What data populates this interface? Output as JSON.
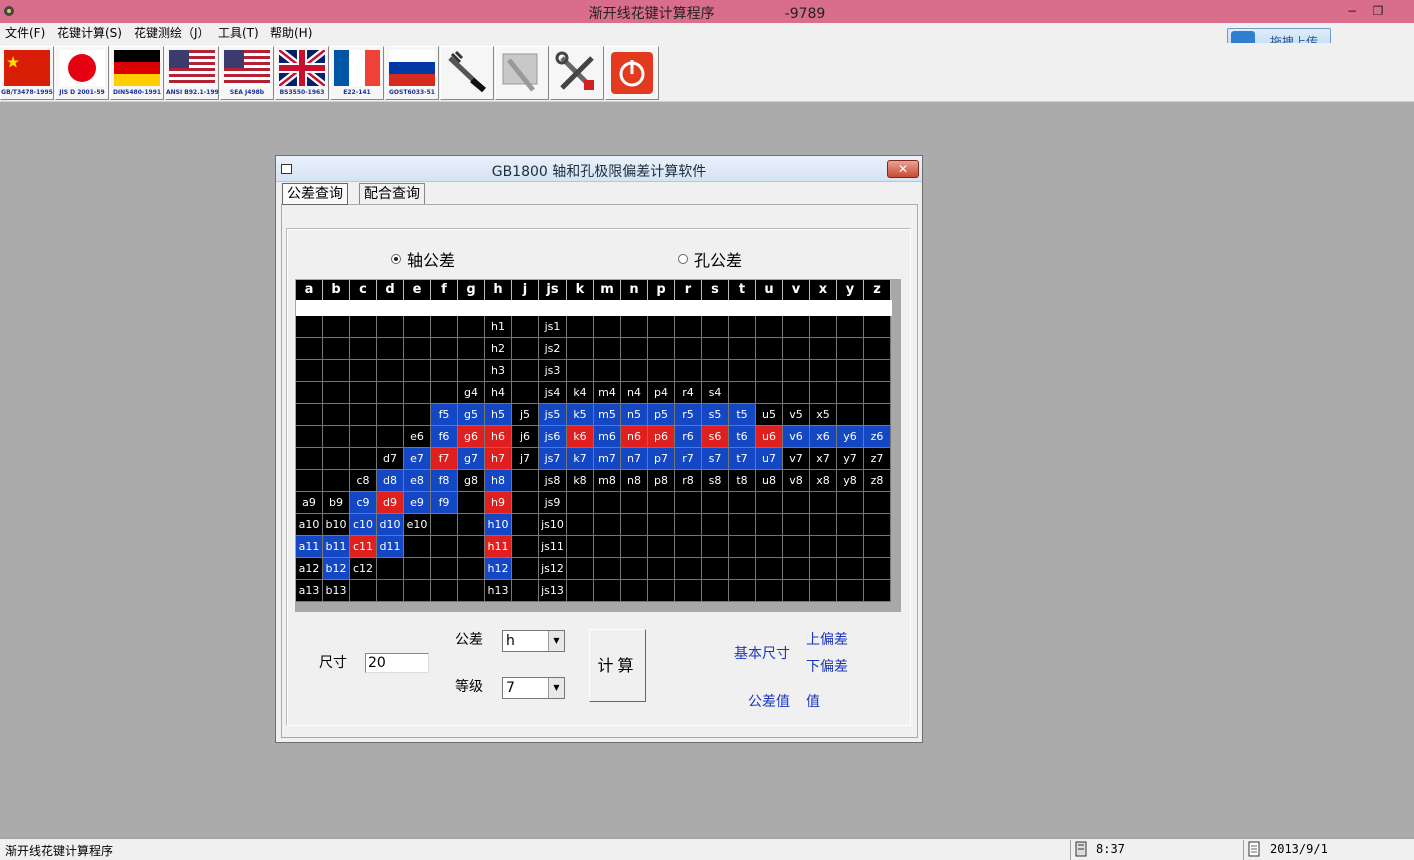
{
  "window": {
    "title": "渐开线花键计算程序",
    "title_code": "-9789",
    "minimize": "−",
    "restore": "❐"
  },
  "menu": [
    {
      "label": "文件(F)"
    },
    {
      "label": "花键计算(S)"
    },
    {
      "label": "花键测绘（J）"
    },
    {
      "label": "工具(T)"
    },
    {
      "label": "帮助(H)"
    }
  ],
  "upload_label": "拖拽上传",
  "toolbar": [
    {
      "caption": "GB/T3478-1995",
      "icon": "china-flag-icon"
    },
    {
      "caption": "JIS D 2001-59",
      "icon": "japan-flag-icon"
    },
    {
      "caption": "DIN5480-1991",
      "icon": "germany-flag-icon"
    },
    {
      "caption": "ANSI B92.1-1996",
      "icon": "usa-flag-icon"
    },
    {
      "caption": "SEA J498b",
      "icon": "usa-flag-icon"
    },
    {
      "caption": "BS3550-1963",
      "icon": "uk-flag-icon"
    },
    {
      "caption": "E22-141",
      "icon": "france-flag-icon"
    },
    {
      "caption": "GOST6033-51",
      "icon": "russia-flag-icon"
    },
    {
      "caption": "",
      "icon": "caliper-icon"
    },
    {
      "caption": "",
      "icon": "drawing-disabled-icon"
    },
    {
      "caption": "",
      "icon": "tools-icon"
    },
    {
      "caption": "",
      "icon": "power-exit-icon"
    }
  ],
  "dialog": {
    "title": "GB1800 轴和孔极限偏差计算软件",
    "close": "✕",
    "tabs": [
      {
        "label": "公差查询",
        "active": true
      },
      {
        "label": "配合查询",
        "active": false
      }
    ],
    "radio_shaft": "轴公差",
    "radio_hole": "孔公差",
    "selected_radio": "shaft"
  },
  "grid": {
    "columns": [
      "a",
      "b",
      "c",
      "d",
      "e",
      "f",
      "g",
      "h",
      "j",
      "js",
      "k",
      "m",
      "n",
      "p",
      "r",
      "s",
      "t",
      "u",
      "v",
      "x",
      "y",
      "z"
    ],
    "rows": [
      [
        "",
        "",
        "",
        "",
        "",
        "",
        "",
        "h1",
        "",
        "js1",
        "",
        "",
        "",
        "",
        "",
        "",
        "",
        "",
        "",
        "",
        "",
        ""
      ],
      [
        "",
        "",
        "",
        "",
        "",
        "",
        "",
        "h2",
        "",
        "js2",
        "",
        "",
        "",
        "",
        "",
        "",
        "",
        "",
        "",
        "",
        "",
        ""
      ],
      [
        "",
        "",
        "",
        "",
        "",
        "",
        "",
        "h3",
        "",
        "js3",
        "",
        "",
        "",
        "",
        "",
        "",
        "",
        "",
        "",
        "",
        "",
        ""
      ],
      [
        "",
        "",
        "",
        "",
        "",
        "",
        "g4",
        "h4",
        "",
        "js4",
        "k4",
        "m4",
        "n4",
        "p4",
        "r4",
        "s4",
        "",
        "",
        "",
        "",
        "",
        ""
      ],
      [
        "",
        "",
        "",
        "",
        "",
        "f5",
        "g5",
        "h5",
        "j5",
        "js5",
        "k5",
        "m5",
        "n5",
        "p5",
        "r5",
        "s5",
        "t5",
        "u5",
        "v5",
        "x5",
        "",
        ""
      ],
      [
        "",
        "",
        "",
        "",
        "e6",
        "f6",
        "g6",
        "h6",
        "j6",
        "js6",
        "k6",
        "m6",
        "n6",
        "p6",
        "r6",
        "s6",
        "t6",
        "u6",
        "v6",
        "x6",
        "y6",
        "z6"
      ],
      [
        "",
        "",
        "",
        "d7",
        "e7",
        "f7",
        "g7",
        "h7",
        "j7",
        "js7",
        "k7",
        "m7",
        "n7",
        "p7",
        "r7",
        "s7",
        "t7",
        "u7",
        "v7",
        "x7",
        "y7",
        "z7"
      ],
      [
        "",
        "",
        "c8",
        "d8",
        "e8",
        "f8",
        "g8",
        "h8",
        "",
        "js8",
        "k8",
        "m8",
        "n8",
        "p8",
        "r8",
        "s8",
        "t8",
        "u8",
        "v8",
        "x8",
        "y8",
        "z8"
      ],
      [
        "a9",
        "b9",
        "c9",
        "d9",
        "e9",
        "f9",
        "",
        "h9",
        "",
        "js9",
        "",
        "",
        "",
        "",
        "",
        "",
        "",
        "",
        "",
        "",
        "",
        ""
      ],
      [
        "a10",
        "b10",
        "c10",
        "d10",
        "e10",
        "",
        "",
        "h10",
        "",
        "js10",
        "",
        "",
        "",
        "",
        "",
        "",
        "",
        "",
        "",
        "",
        "",
        ""
      ],
      [
        "a11",
        "b11",
        "c11",
        "d11",
        "",
        "",
        "",
        "h11",
        "",
        "js11",
        "",
        "",
        "",
        "",
        "",
        "",
        "",
        "",
        "",
        "",
        "",
        ""
      ],
      [
        "a12",
        "b12",
        "c12",
        "",
        "",
        "",
        "",
        "h12",
        "",
        "js12",
        "",
        "",
        "",
        "",
        "",
        "",
        "",
        "",
        "",
        "",
        "",
        ""
      ],
      [
        "a13",
        "b13",
        "",
        "",
        "",
        "",
        "",
        "h13",
        "",
        "js13",
        "",
        "",
        "",
        "",
        "",
        "",
        "",
        "",
        "",
        "",
        "",
        ""
      ]
    ],
    "colors": {
      "blue": "#1347c4",
      "red": "#e01f1f",
      "black": "#000000"
    },
    "highlight": {
      "blue": [
        "f5",
        "g5",
        "h5",
        "js5",
        "k5",
        "m5",
        "n5",
        "p5",
        "r5",
        "s5",
        "t5",
        "v6",
        "x6",
        "y6",
        "z6",
        "f6",
        "js6",
        "m6",
        "r6",
        "t6",
        "e7",
        "g7",
        "js7",
        "k7",
        "m7",
        "n7",
        "p7",
        "r7",
        "s7",
        "t7",
        "u7",
        "d8",
        "e8",
        "f8",
        "h8",
        "c9",
        "e9",
        "f9",
        "c10",
        "d10",
        "h10",
        "a11",
        "b11",
        "d11",
        "b12",
        "h12"
      ],
      "red": [
        "g6",
        "h6",
        "k6",
        "n6",
        "p6",
        "s6",
        "u6",
        "f7",
        "h7",
        "d9",
        "h9",
        "c11",
        "h11"
      ]
    }
  },
  "form": {
    "size_label": "尺寸",
    "size_value": "20",
    "tolerance_label": "公差",
    "tolerance_value": "h",
    "grade_label": "等级",
    "grade_value": "7",
    "calc_label": "计算",
    "basic_size_label": "基本尺寸",
    "upper_dev_label": "上偏差",
    "lower_dev_label": "下偏差",
    "tol_value_label": "公差值",
    "value_label": "值"
  },
  "status": {
    "left": "渐开线花键计算程序",
    "time": "8:37",
    "date": "2013/9/1"
  }
}
